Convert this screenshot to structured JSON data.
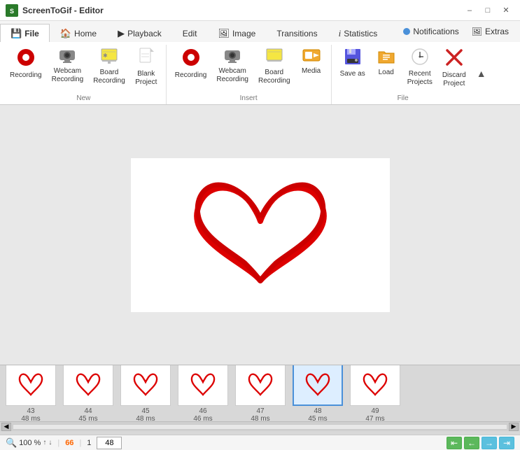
{
  "titleBar": {
    "appName": "ScreenToGif - Editor",
    "appIconLabel": "S",
    "controls": {
      "minimize": "–",
      "maximize": "□",
      "close": "✕"
    }
  },
  "tabs": [
    {
      "id": "file",
      "label": "File",
      "icon": "💾",
      "active": true
    },
    {
      "id": "home",
      "label": "Home",
      "icon": "🏠",
      "active": false
    },
    {
      "id": "playback",
      "label": "Playback",
      "icon": "▶",
      "active": false
    },
    {
      "id": "edit",
      "label": "Edit",
      "icon": "",
      "active": false
    },
    {
      "id": "image",
      "label": "Image",
      "icon": "🖼",
      "active": false
    },
    {
      "id": "transitions",
      "label": "Transitions",
      "icon": "",
      "active": false
    },
    {
      "id": "statistics",
      "label": "Statistics",
      "icon": "i",
      "active": false
    }
  ],
  "tabRight": {
    "notifications": "Notifications",
    "extras": "Extras"
  },
  "ribbon": {
    "groups": [
      {
        "id": "new",
        "label": "New",
        "items": [
          {
            "id": "recording",
            "icon": "🔴",
            "label": "Recording"
          },
          {
            "id": "webcam-recording",
            "icon": "📷",
            "label": "Webcam\nRecording"
          },
          {
            "id": "board-recording",
            "icon": "🎨",
            "label": "Board\nRecording"
          },
          {
            "id": "blank-project",
            "icon": "📄",
            "label": "Blank\nProject"
          }
        ]
      },
      {
        "id": "insert",
        "label": "Insert",
        "items": [
          {
            "id": "recording-insert",
            "icon": "🔴",
            "label": "Recording"
          },
          {
            "id": "webcam-insert",
            "icon": "📷",
            "label": "Webcam\nRecording"
          },
          {
            "id": "board-insert",
            "icon": "🎨",
            "label": "Board\nRecording"
          },
          {
            "id": "media",
            "icon": "📁",
            "label": "Media"
          }
        ]
      },
      {
        "id": "file",
        "label": "File",
        "items": [
          {
            "id": "save-as",
            "icon": "💾",
            "label": "Save as"
          },
          {
            "id": "load",
            "icon": "📂",
            "label": "Load"
          },
          {
            "id": "recent-projects",
            "icon": "🕐",
            "label": "Recent\nProjects"
          },
          {
            "id": "discard-project",
            "icon": "✖",
            "label": "Discard\nProject"
          }
        ]
      }
    ]
  },
  "filmstrip": {
    "frames": [
      {
        "number": "43",
        "time": "48 ms",
        "selected": false
      },
      {
        "number": "44",
        "time": "45 ms",
        "selected": false
      },
      {
        "number": "45",
        "time": "48 ms",
        "selected": false
      },
      {
        "number": "46",
        "time": "46 ms",
        "selected": false
      },
      {
        "number": "47",
        "time": "48 ms",
        "selected": false
      },
      {
        "number": "48",
        "time": "45 ms",
        "selected": true
      },
      {
        "number": "49",
        "time": "47 ms",
        "selected": false
      }
    ]
  },
  "statusBar": {
    "zoomIcon": "🔍",
    "zoomValue": "100",
    "zoomPct": "%",
    "frameCount": "66",
    "frameCountLabel": "↑",
    "currentFrame": "1",
    "totalFrames": "48",
    "navFirst": "⇤",
    "navPrev": "←",
    "navNext": "→",
    "navLast": "⇥"
  }
}
